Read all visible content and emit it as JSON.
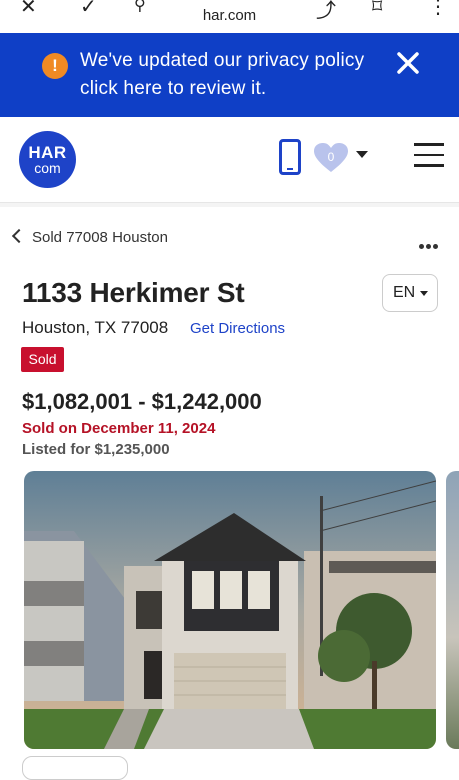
{
  "browser": {
    "url": "har.com"
  },
  "privacy_banner": {
    "message": "We've updated our privacy policy click here to review it.",
    "warning_glyph": "!",
    "accent": "#0f3fc6"
  },
  "header": {
    "logo_top": "HAR",
    "logo_bottom": "com",
    "favorites_count": "0"
  },
  "breadcrumb": {
    "label": "Sold 77008 Houston"
  },
  "listing": {
    "address": "1133 Herkimer St",
    "city_line": "Houston, TX 77008",
    "directions_label": "Get Directions",
    "status_badge": "Sold",
    "price_range": "$1,082,001 - $1,242,000",
    "sold_date": "Sold on December 11, 2024",
    "listed_for": "Listed for $1,235,000",
    "language": "EN"
  },
  "colors": {
    "brand_blue": "#1e43c8",
    "sold_red": "#c8102e",
    "warning_orange": "#f08a24"
  }
}
